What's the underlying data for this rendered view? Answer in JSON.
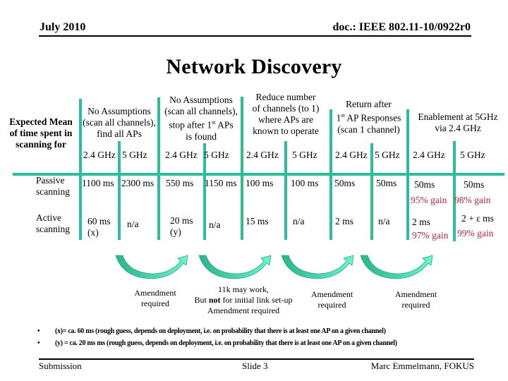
{
  "header": {
    "date": "July 2010",
    "doc_id": "doc.: IEEE 802.11-10/0922r0"
  },
  "title": "Network Discovery",
  "table": {
    "row_label_header": [
      "Expected Mean",
      "of time spent in",
      "scanning for"
    ],
    "columns": [
      {
        "heading": [
          "No Assumptions",
          "(scan all channels),",
          "find all APs"
        ],
        "bands": [
          "2.4 GHz",
          "5 GHz"
        ],
        "passive": [
          "1100 ms",
          "2300 ms"
        ],
        "active": [
          [
            "60 ms",
            "(x)"
          ],
          [
            "n/a"
          ]
        ]
      },
      {
        "heading": [
          "No Assumptions",
          "(scan all channels),",
          "stop after 1st APs",
          "is found"
        ],
        "bands": [
          "2.4 GHz",
          "5 GHz"
        ],
        "passive": [
          "550 ms",
          "1150 ms"
        ],
        "active": [
          [
            "20 ms",
            "(y)"
          ],
          [
            "n/a"
          ]
        ]
      },
      {
        "heading": [
          "Reduce number",
          "of channels (to 1)",
          "where APs are",
          "known to operate"
        ],
        "bands": [
          "2.4 GHz",
          "5 GHz"
        ],
        "passive": [
          "100 ms",
          "100 ms"
        ],
        "active": [
          [
            "15 ms"
          ],
          [
            "n/a"
          ]
        ]
      },
      {
        "heading": [
          "Return after",
          "1st AP Responses",
          "(scan 1 channel)"
        ],
        "bands": [
          "2.4 GHz",
          "5 GHz"
        ],
        "passive": [
          "50ms",
          "50ms"
        ],
        "active": [
          [
            "2 ms"
          ],
          [
            "n/a"
          ]
        ]
      },
      {
        "heading": [
          "Enablement at 5GHz",
          "via 2.4 GHz"
        ],
        "bands": [
          "2.4 GHz",
          "5 GHz"
        ],
        "passive": [
          "50ms",
          "50ms"
        ],
        "passive_gain": [
          "95% gain",
          "98% gain"
        ],
        "active": [
          [
            "2 ms"
          ],
          [
            "2 + ε  ms"
          ]
        ],
        "active_gain": [
          "97% gain",
          "99% gain"
        ]
      }
    ],
    "rows": [
      {
        "label": [
          "Passive",
          "scanning"
        ]
      },
      {
        "label": [
          "Active",
          "scanning"
        ]
      }
    ]
  },
  "transitions": [
    {
      "label": [
        "Amendment",
        "required"
      ]
    },
    {
      "label_pre": "11k may work,",
      "label_mid_a": "But ",
      "label_mid_bold": "not",
      "label_mid_b": " for initial link set-up",
      "label_post": "Amendment required"
    },
    {
      "label": [
        "Amendment",
        "required"
      ]
    },
    {
      "label": [
        "Amendment",
        "required"
      ]
    }
  ],
  "notes": [
    "(x)= ca. 60 ms (rough guess, depends on deployment, i.e. on probability that there is at least one AP on a given channel)",
    "(y) = ca. 20 ms ms (rough guess, depends on deployment, i.e. on probability that there is at least one AP on a given channel)"
  ],
  "footer": {
    "left": "Submission",
    "center": "Slide 3",
    "right": "Marc Emmelmann, FOKUS"
  },
  "colors": {
    "grid": "#2bbf99",
    "gain_text": "#b0283a",
    "arrow_light": "#5ef0c8",
    "arrow_dark": "#2bb38a"
  }
}
